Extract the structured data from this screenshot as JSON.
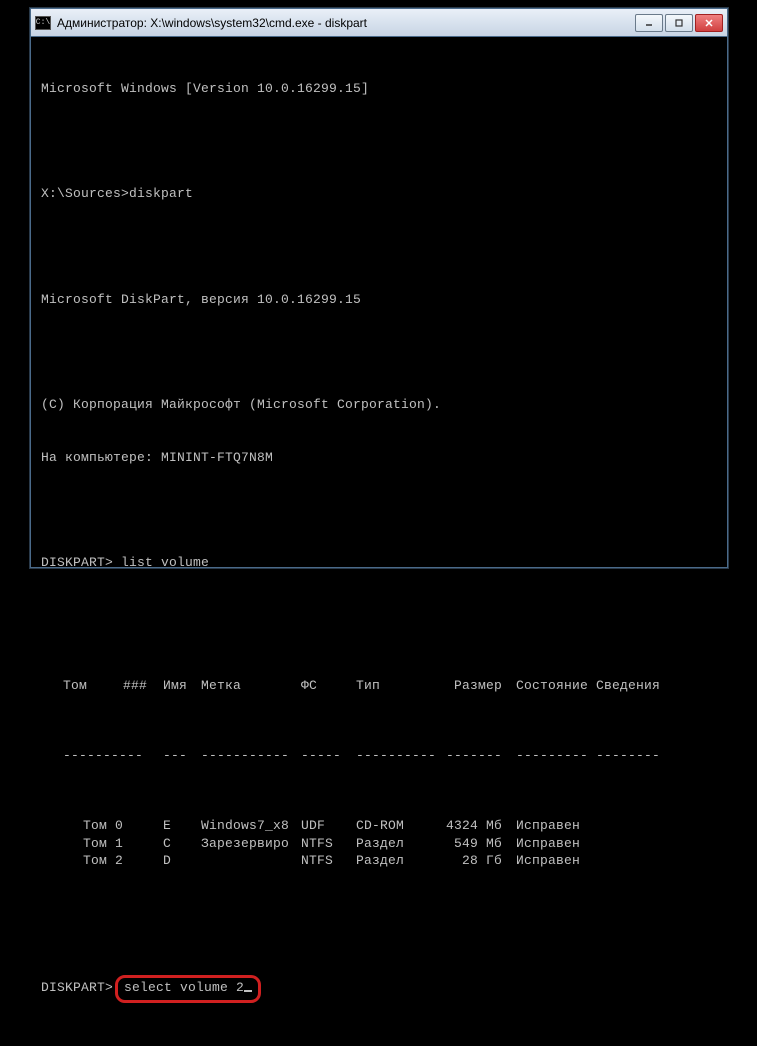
{
  "window": {
    "title": "Администратор: X:\\windows\\system32\\cmd.exe - diskpart"
  },
  "terminal": {
    "header": "Microsoft Windows [Version 10.0.16299.15]",
    "prompt1_path": "X:\\Sources>",
    "prompt1_cmd": "diskpart",
    "diskpart_version": "Microsoft DiskPart, версия 10.0.16299.15",
    "copyright": "(C) Корпорация Майкрософт (Microsoft Corporation).",
    "computer": "На компьютере: MININT-FTQ7N8M",
    "prompt2_label": "DISKPART> ",
    "prompt2_cmd": "list volume",
    "table": {
      "headers": {
        "tom": "Том",
        "num": "###",
        "name": "Имя",
        "label": "Метка",
        "fs": "ФС",
        "type": "Тип",
        "size": "Размер",
        "state": "Состояние",
        "info": "Сведения"
      },
      "rows": [
        {
          "tom": "Том 0",
          "name": "E",
          "label": "Windows7_x8",
          "fs": "UDF",
          "type": "CD-ROM",
          "size": "4324 Мб",
          "state": "Исправен"
        },
        {
          "tom": "Том 1",
          "name": "C",
          "label": "Зарезервиро",
          "fs": "NTFS",
          "type": "Раздел",
          "size": "549 Мб",
          "state": "Исправен"
        },
        {
          "tom": "Том 2",
          "name": "D",
          "label": "",
          "fs": "NTFS",
          "type": "Раздел",
          "size": "28 Гб",
          "state": "Исправен"
        }
      ]
    },
    "prompt3_label": "DISKPART> ",
    "prompt3_cmd": "select volume 2"
  }
}
